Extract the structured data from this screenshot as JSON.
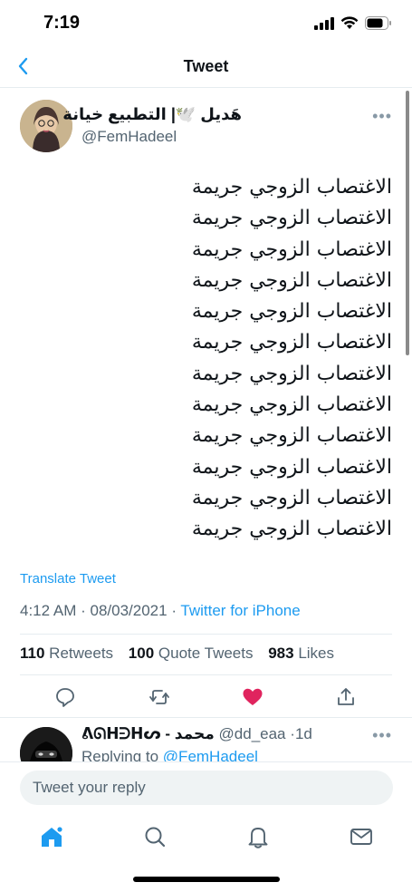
{
  "status_bar": {
    "time": "7:19"
  },
  "nav": {
    "title": "Tweet"
  },
  "tweet": {
    "author_name": "هَديل 🕊️| التطبيع خيانة",
    "handle": "@FemHadeel",
    "lines": [
      "الاغتصاب الزوجي جريمة",
      "الاغتصاب الزوجي جريمة",
      "الاغتصاب الزوجي جريمة",
      "الاغتصاب الزوجي جريمة",
      "الاغتصاب الزوجي جريمة",
      "الاغتصاب الزوجي جريمة",
      "الاغتصاب الزوجي جريمة",
      "الاغتصاب الزوجي جريمة",
      "الاغتصاب الزوجي جريمة",
      "الاغتصاب الزوجي جريمة",
      "الاغتصاب الزوجي جريمة",
      "الاغتصاب الزوجي جريمة"
    ],
    "translate_label": "Translate Tweet",
    "time": "4:12 AM",
    "date": "08/03/2021",
    "source": "Twitter for iPhone",
    "retweets": "110",
    "retweets_label": "Retweets",
    "quote_tweets": "100",
    "quote_tweets_label": "Quote Tweets",
    "likes": "983",
    "likes_label": "Likes"
  },
  "reply": {
    "author_name": "ᕕᘏᕼᕭᕼᔕ - محمد",
    "handle": "@dd_eaa",
    "age": "1d",
    "replying_prefix": "Replying to",
    "replying_to": "@FemHadeel"
  },
  "composer": {
    "placeholder": "Tweet your reply"
  },
  "colors": {
    "accent": "#1d9bf0",
    "like": "#e0245e",
    "muted": "#536471"
  },
  "icons": [
    "back-chevron-icon",
    "more-icon",
    "reply-icon",
    "retweet-icon",
    "heart-filled-icon",
    "share-icon",
    "home-icon",
    "search-icon",
    "notifications-icon",
    "messages-icon"
  ]
}
